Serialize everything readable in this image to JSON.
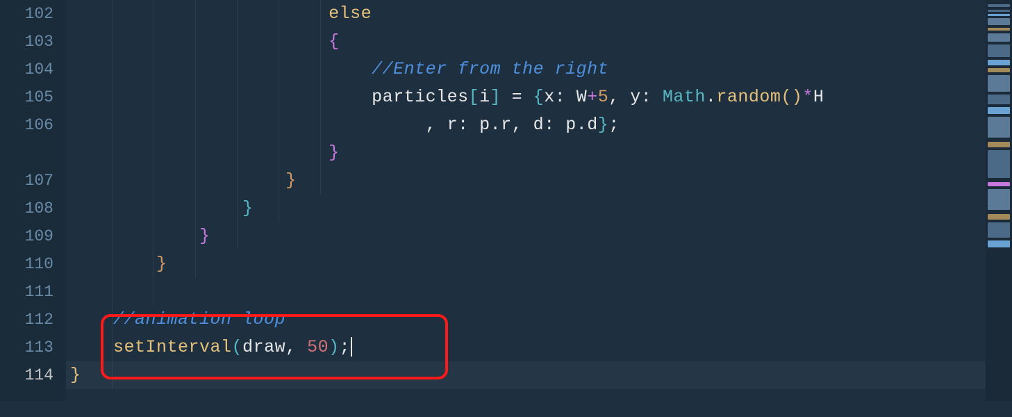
{
  "gutter": {
    "lines": [
      "102",
      "103",
      "104",
      "105",
      "106",
      "107",
      "108",
      "109",
      "110",
      "111",
      "112",
      "113",
      "114"
    ],
    "activeLine": "113"
  },
  "code": {
    "l102": {
      "indent": "                        ",
      "kw": "else"
    },
    "l103": {
      "indent": "                        ",
      "brace": "{"
    },
    "l104": {
      "indent": "                            ",
      "comment": "//Enter from the right"
    },
    "l105": {
      "indent": "                            ",
      "arr": "particles",
      "idx": "i",
      "eq": " = ",
      "xkey": "x",
      "w": "W",
      "plus": "+",
      "five": "5",
      "ykey": "y",
      "math": "Math",
      "rand": "random",
      "star": "*",
      "h": "H"
    },
    "l105wrap": {
      "indent": "                                 ",
      "rkey": "r",
      "pr": "p.r",
      "dkey": "d",
      "pd": "p.d"
    },
    "l106": {
      "indent": "                        ",
      "brace": "}"
    },
    "l107": {
      "indent": "                    ",
      "brace": "}"
    },
    "l108": {
      "indent": "                ",
      "brace": "}"
    },
    "l109": {
      "indent": "            ",
      "brace": "}"
    },
    "l110": {
      "indent": "        ",
      "brace": "}"
    },
    "l111": {
      "text": ""
    },
    "l112": {
      "indent": "    ",
      "comment": "//animation loop"
    },
    "l113": {
      "indent": "    ",
      "fn": "setInterval",
      "arg1": "draw",
      "arg2": "50"
    },
    "l114": {
      "brace": "}"
    }
  }
}
